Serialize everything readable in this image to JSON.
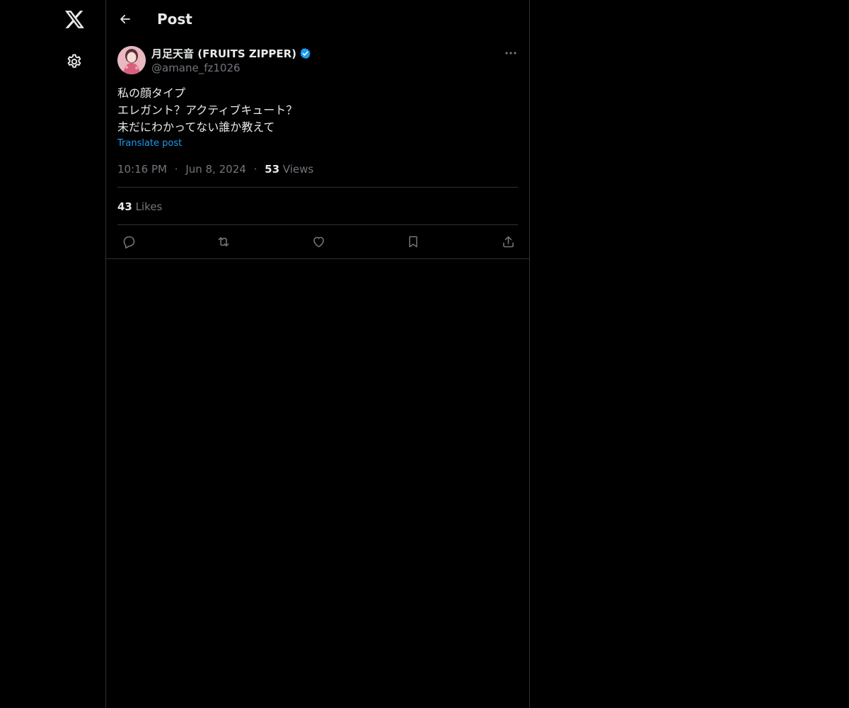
{
  "nav": {
    "logo_icon": "x-logo-icon",
    "settings_icon": "gear-icon"
  },
  "header": {
    "back_icon": "arrow-left-icon",
    "title": "Post"
  },
  "post": {
    "author": {
      "display_name": "月足天音 (FRUITS ZIPPER)",
      "handle": "@amane_fz1026",
      "verified": true,
      "avatar_icon": "avatar-photo"
    },
    "text_lines": [
      "私の顔タイプ",
      "エレガント？アクティブキュート？",
      "未だにわかってない誰か教えて"
    ],
    "translate_label": "Translate post",
    "time": "10:16 PM",
    "separator": "·",
    "date": "Jun 8, 2024",
    "views_count": "53",
    "views_label": "Views",
    "likes_count": "43",
    "likes_label": "Likes",
    "actions": [
      "reply-icon",
      "repost-icon",
      "like-icon",
      "bookmark-icon",
      "share-icon"
    ]
  },
  "colors": {
    "background": "#000000",
    "text_primary": "#e7e9ea",
    "text_secondary": "#71767b",
    "accent": "#1d9bf0",
    "border": "#2f3336"
  }
}
